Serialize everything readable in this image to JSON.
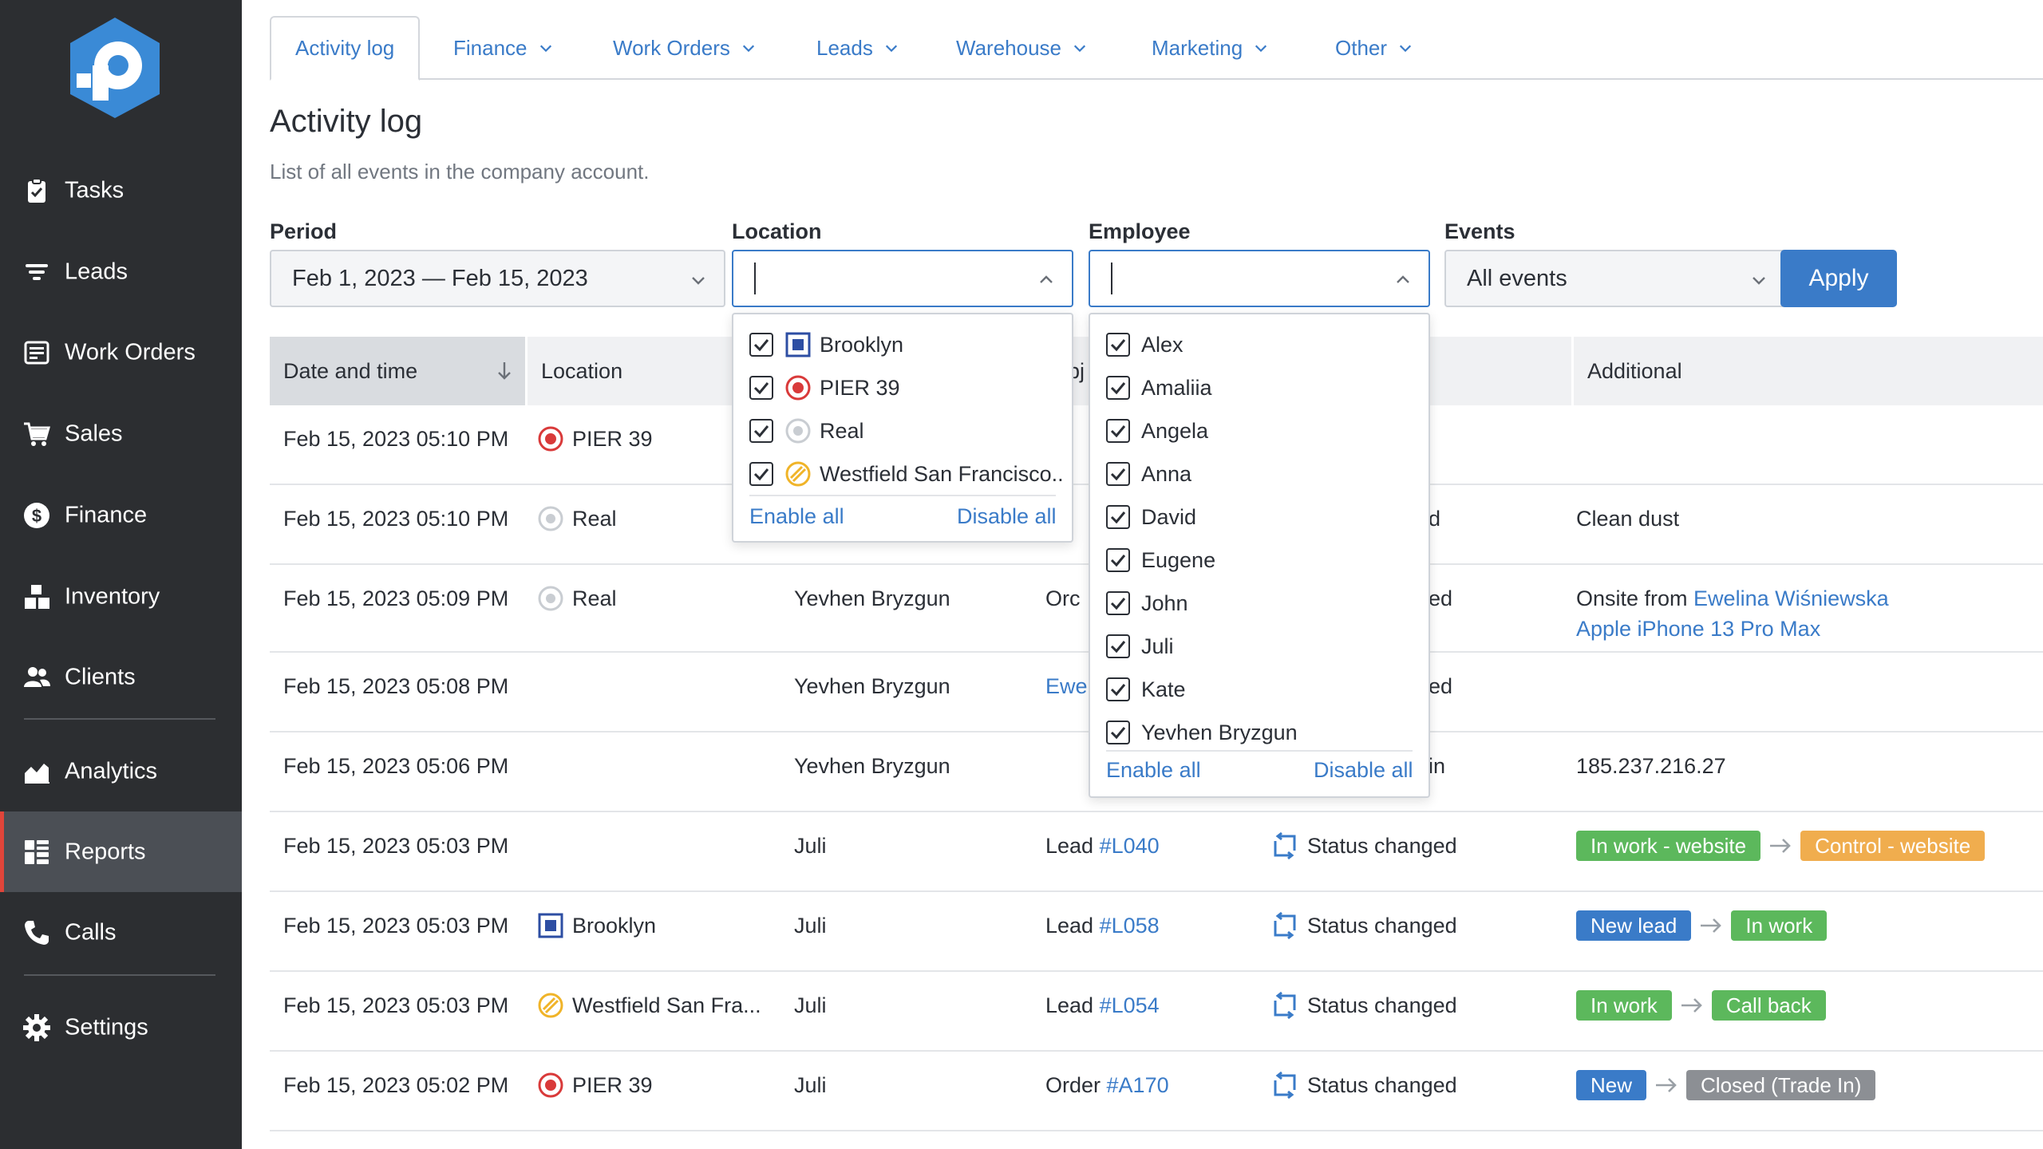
{
  "sidebar": {
    "items": [
      {
        "label": "Tasks",
        "icon": "clipboard-icon"
      },
      {
        "label": "Leads",
        "icon": "filter-icon"
      },
      {
        "label": "Work Orders",
        "icon": "work-order-icon"
      },
      {
        "label": "Sales",
        "icon": "cart-icon"
      },
      {
        "label": "Finance",
        "icon": "dollar-icon"
      },
      {
        "label": "Inventory",
        "icon": "boxes-icon"
      },
      {
        "label": "Clients",
        "icon": "users-icon"
      },
      {
        "label": "Analytics",
        "icon": "chart-icon"
      },
      {
        "label": "Reports",
        "icon": "grid-icon",
        "active": true
      },
      {
        "label": "Calls",
        "icon": "phone-icon"
      },
      {
        "label": "Settings",
        "icon": "gear-icon"
      }
    ]
  },
  "tabs": [
    {
      "label": "Activity log",
      "active": true
    },
    {
      "label": "Finance"
    },
    {
      "label": "Work Orders"
    },
    {
      "label": "Leads"
    },
    {
      "label": "Warehouse"
    },
    {
      "label": "Marketing"
    },
    {
      "label": "Other"
    }
  ],
  "page": {
    "title": "Activity log",
    "subtitle": "List of all events in the company account."
  },
  "filters": {
    "period_label": "Period",
    "period_value": "Feb 1, 2023 — Feb 15, 2023",
    "location_label": "Location",
    "location_value": "",
    "employee_label": "Employee",
    "employee_value": "",
    "events_label": "Events",
    "events_value": "All events",
    "apply_label": "Apply"
  },
  "table": {
    "headers": {
      "date": "Date and time",
      "location": "Location",
      "object_partial": "bj",
      "additional": "Additional"
    },
    "rows": [
      {
        "date": "Feb 15, 2023 05:10 PM",
        "location": "PIER 39",
        "location_icon": "pier39",
        "employee": "",
        "object_prefix": "",
        "object_link": "",
        "object_partial": "l",
        "event": "",
        "event_partial": "",
        "additional": ""
      },
      {
        "date": "Feb 15, 2023 05:10 PM",
        "location": "Real",
        "location_icon": "real",
        "employee": "",
        "object_prefix": "",
        "object_link": "",
        "object_partial": "r",
        "event": "",
        "event_partial": "d",
        "additional": "Clean dust"
      },
      {
        "date": "Feb 15, 2023 05:09 PM",
        "location": "Real",
        "location_icon": "real",
        "employee": "Yevhen Bryzgun",
        "object_prefix": "",
        "object_link": "",
        "object_partial": "Orc",
        "event": "",
        "event_partial": "ed",
        "additional_prefix": "Onsite from ",
        "additional_link": "Ewelina Wiśniewska",
        "additional_link2": "Apple iPhone 13 Pro Max"
      },
      {
        "date": "Feb 15, 2023 05:08 PM",
        "location": "",
        "location_icon": "",
        "employee": "Yevhen Bryzgun",
        "object_prefix": "",
        "object_link": "Ewe",
        "object_partial": "",
        "event": "",
        "event_partial": "ed",
        "additional": ""
      },
      {
        "date": "Feb 15, 2023 05:06 PM",
        "location": "",
        "location_icon": "",
        "employee": "Yevhen Bryzgun",
        "object_prefix": "",
        "object_link": "",
        "object_partial": "",
        "event": "",
        "event_partial": "in",
        "additional": "185.237.216.27"
      },
      {
        "date": "Feb 15, 2023 05:03 PM",
        "location": "",
        "location_icon": "",
        "employee": "Juli",
        "object_prefix": "Lead ",
        "object_link": "#L040",
        "event": "Status changed",
        "from_status": "In work - website",
        "from_color": "#5cb85c",
        "to_status": "Control - website",
        "to_color": "#f0ad4e"
      },
      {
        "date": "Feb 15, 2023 05:03 PM",
        "location": "Brooklyn",
        "location_icon": "brooklyn",
        "employee": "Juli",
        "object_prefix": "Lead ",
        "object_link": "#L058",
        "event": "Status changed",
        "from_status": "New lead",
        "from_color": "#3a7bc8",
        "to_status": "In work",
        "to_color": "#5cb85c"
      },
      {
        "date": "Feb 15, 2023 05:03 PM",
        "location": "Westfield San Fra...",
        "location_icon": "westfield",
        "employee": "Juli",
        "object_prefix": "Lead ",
        "object_link": "#L054",
        "event": "Status changed",
        "from_status": "In work",
        "from_color": "#5cb85c",
        "to_status": "Call back",
        "to_color": "#5cb85c"
      },
      {
        "date": "Feb 15, 2023 05:02 PM",
        "location": "PIER 39",
        "location_icon": "pier39",
        "employee": "Juli",
        "object_prefix": "Order ",
        "object_link": "#A170",
        "event": "Status changed",
        "from_status": "New",
        "from_color": "#3a7bc8",
        "to_status": "Closed (Trade In)",
        "to_color": "#8c8f94"
      }
    ]
  },
  "location_dropdown": {
    "items": [
      {
        "label": "Brooklyn",
        "icon": "brooklyn",
        "checked": true
      },
      {
        "label": "PIER 39",
        "icon": "pier39",
        "checked": true
      },
      {
        "label": "Real",
        "icon": "real",
        "checked": true
      },
      {
        "label": "Westfield San Francisco..",
        "icon": "westfield",
        "checked": true
      }
    ],
    "enable_all": "Enable all",
    "disable_all": "Disable all"
  },
  "employee_dropdown": {
    "items": [
      {
        "label": "Alex",
        "checked": true
      },
      {
        "label": "Amaliia",
        "checked": true
      },
      {
        "label": "Angela",
        "checked": true
      },
      {
        "label": "Anna",
        "checked": true
      },
      {
        "label": "David",
        "checked": true
      },
      {
        "label": "Eugene",
        "checked": true
      },
      {
        "label": "John",
        "checked": true
      },
      {
        "label": "Juli",
        "checked": true
      },
      {
        "label": "Kate",
        "checked": true
      },
      {
        "label": "Yevhen Bryzgun",
        "checked": true
      }
    ],
    "enable_all": "Enable all",
    "disable_all": "Disable all"
  },
  "colors": {
    "sidebar_bg": "#2c2e31",
    "accent": "#3a7bc8",
    "active_marker": "#e0453a",
    "status_green": "#5cb85c",
    "status_orange": "#f0ad4e",
    "status_blue": "#3a7bc8",
    "status_gray": "#8c8f94"
  }
}
